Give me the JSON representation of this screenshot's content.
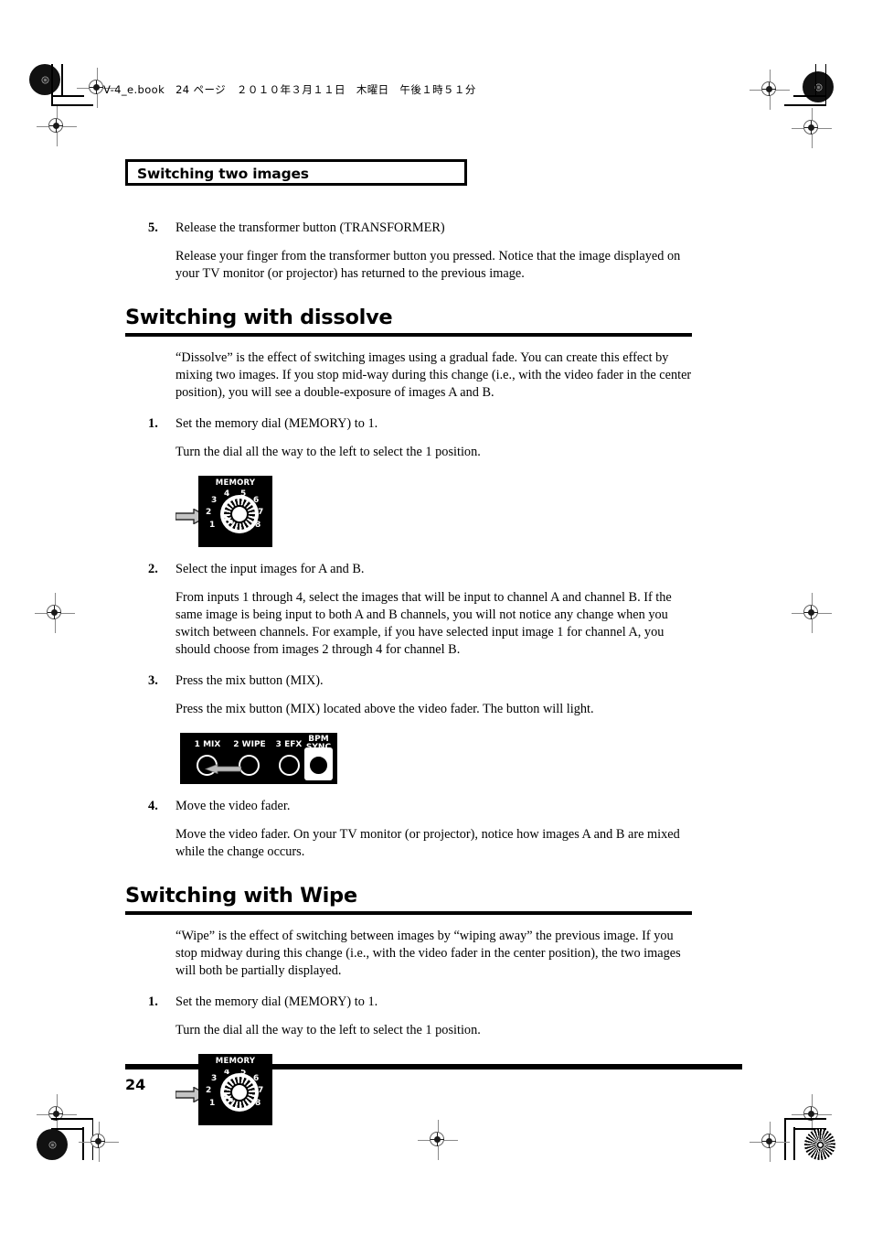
{
  "print": {
    "slug": "V-4_e.book　24 ページ　２０１０年３月１１日　木曜日　午後１時５１分"
  },
  "chapter": {
    "title": "Switching two images"
  },
  "sections": [
    {
      "id": "continued-step",
      "steps": [
        {
          "num": "5.",
          "heading": "Release the transformer button (TRANSFORMER)",
          "body": "Release your finger from the transformer button you pressed. Notice that the image displayed on your TV monitor (or projector) has returned to the previous image."
        }
      ]
    },
    {
      "id": "dissolve",
      "heading": "Switching with dissolve",
      "intro": "“Dissolve” is the effect of switching images using a gradual fade. You can create this effect by mixing two images. If you stop mid-way during this change (i.e., with the video fader in the center position), you will see a double-exposure of images A and B.",
      "steps": [
        {
          "num": "1.",
          "heading": "Set the memory dial (MEMORY) to 1.",
          "body": "Turn the dial all the way to the left to select the 1 position."
        },
        {
          "num": "2.",
          "heading": "Select the input images for A and B.",
          "body": "From inputs 1 through 4, select the images that will be input to channel A and channel B. If the same image is being input to both A and B channels, you will not notice any change when you switch between channels. For example, if you have selected input image 1 for channel A, you should choose from images 2 through 4 for channel B."
        },
        {
          "num": "3.",
          "heading": "Press the mix button (MIX).",
          "body": "Press the mix button (MIX) located above the video fader. The button will light."
        },
        {
          "num": "4.",
          "heading": "Move the video fader.",
          "body": "Move the video fader. On your TV monitor (or projector), notice how images A and B are mixed while the change occurs."
        }
      ]
    },
    {
      "id": "wipe",
      "heading": "Switching with Wipe",
      "intro": "“Wipe” is the effect of switching between images by “wiping away” the previous image. If you stop midway during this change (i.e., with the video fader in the center position), the two images will both be partially displayed.",
      "steps": [
        {
          "num": "1.",
          "heading": "Set the memory dial (MEMORY) to 1.",
          "body": "Turn the dial all the way to the left to select the 1 position."
        }
      ]
    }
  ],
  "figures": {
    "memory_dial": {
      "title": "MEMORY",
      "positions": [
        "1",
        "2",
        "3",
        "4",
        "5",
        "6",
        "7",
        "8"
      ],
      "selected": "1",
      "callout": "arrow-pointing-to-position-1"
    },
    "transition_buttons": {
      "buttons": [
        {
          "label": "1 MIX",
          "lit": true
        },
        {
          "label": "2 WIPE",
          "lit": false
        },
        {
          "label": "3 EFX",
          "lit": false
        },
        {
          "label": "BPM\nSYNC",
          "lit": false,
          "highlighted": true
        }
      ],
      "bpm_line1": "BPM",
      "bpm_line2": "SYNC",
      "callout": "arrow-pointing-to-mix-button"
    }
  },
  "footer": {
    "page_number": "24"
  },
  "colors": {
    "ink": "#000000",
    "paper": "#ffffff",
    "callout_arrow": "#bfbfbf",
    "reg_mark": "#8a8a8a"
  }
}
